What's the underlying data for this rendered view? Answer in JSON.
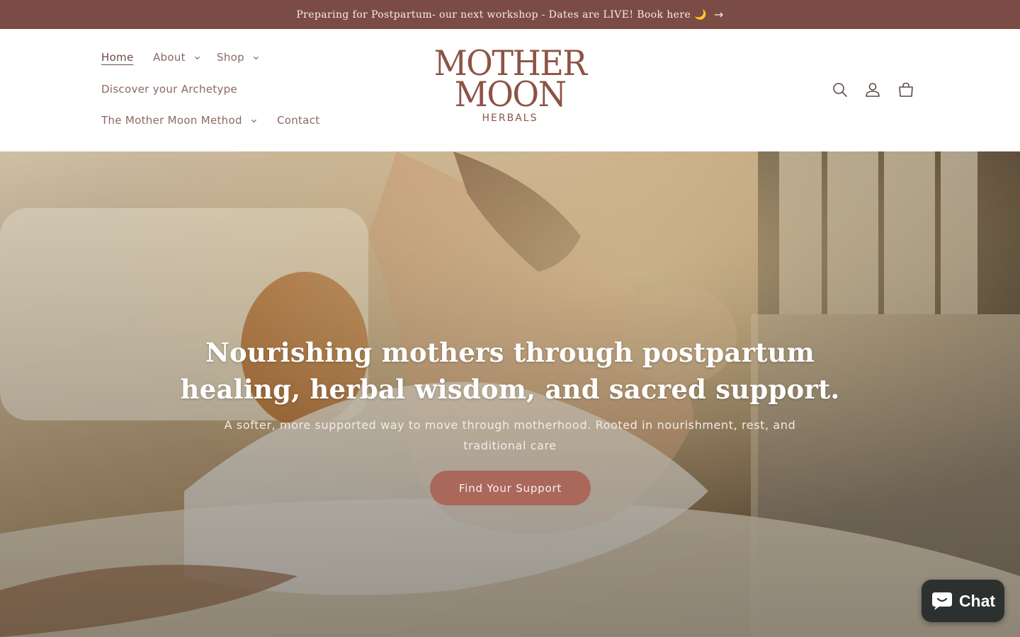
{
  "announcement": {
    "text": "Preparing for Postpartum- our next workshop - Dates are LIVE! Book here 🌙",
    "arrow": "→"
  },
  "nav": {
    "home": "Home",
    "about": "About",
    "shop": "Shop",
    "archetype": "Discover your Archetype",
    "method": "The Mother Moon Method",
    "contact": "Contact"
  },
  "logo": {
    "line1": "MOTHER",
    "line2": "MOON",
    "line3": "HERBALS"
  },
  "header_icons": [
    "search-icon",
    "account-icon",
    "cart-icon"
  ],
  "hero": {
    "title": "Nourishing mothers through postpartum healing, herbal wisdom, and sacred support.",
    "subtitle": "A softer, more supported way to move through motherhood. Rooted in nourishment, rest, and traditional care",
    "cta": "Find Your Support"
  },
  "chat": {
    "label": "Chat"
  },
  "colors": {
    "announcement_bg": "#7b4c45",
    "brand": "#8c5446",
    "nav_text": "#8a6a64",
    "cta_bg": "#a9685a",
    "chat_bg": "#2c312f"
  }
}
